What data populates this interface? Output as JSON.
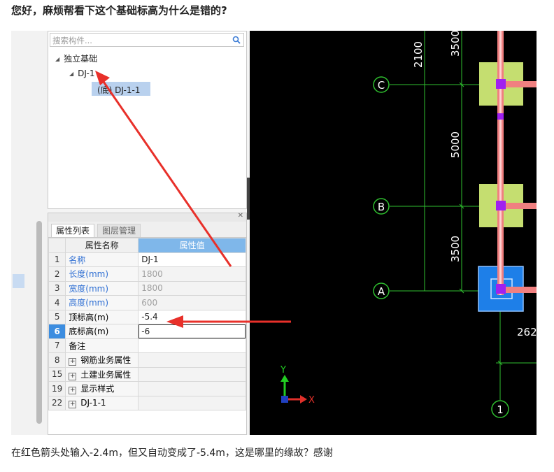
{
  "question_title": "您好，麻烦帮看下这个基础标高为什么是错的?",
  "caption": "在红色箭头处输入-2.4m，但又自动变成了-5.4m，这是哪里的缘故？感谢",
  "tree": {
    "search_placeholder": "搜索构件...",
    "root_label": "独立基础",
    "child_label": "DJ-1",
    "leaf_label": "(底) DJ-1-1"
  },
  "property_panel": {
    "tabs": [
      "属性列表",
      "图层管理"
    ],
    "header_name": "属性名称",
    "header_value": "属性值",
    "rows": [
      {
        "num": "1",
        "name": "名称",
        "value": "DJ-1"
      },
      {
        "num": "2",
        "name": "长度(mm)",
        "value": "1800"
      },
      {
        "num": "3",
        "name": "宽度(mm)",
        "value": "1800"
      },
      {
        "num": "4",
        "name": "高度(mm)",
        "value": "600"
      },
      {
        "num": "5",
        "name": "顶标高(m)",
        "value": "-5.4"
      },
      {
        "num": "6",
        "name": "底标高(m)",
        "value": "-6"
      },
      {
        "num": "7",
        "name": "备注",
        "value": ""
      },
      {
        "num": "8",
        "name": "钢筋业务属性",
        "value": ""
      },
      {
        "num": "15",
        "name": "土建业务属性",
        "value": ""
      },
      {
        "num": "19",
        "name": "显示样式",
        "value": ""
      },
      {
        "num": "22",
        "name": "DJ-1-1",
        "value": ""
      }
    ]
  },
  "cad": {
    "dimensions": [
      "2100",
      "3500",
      "5000",
      "3500",
      "262"
    ],
    "axis_labels": [
      "C",
      "B",
      "A",
      "1"
    ],
    "ucs_x": "X",
    "ucs_y": "Y"
  },
  "colors": {
    "arrow_red": "#e8302a",
    "footing_green": "#c5de70",
    "footing_selected": "#1e7fe8",
    "grid_line": "#2fbf2f",
    "column_magenta": "#a020f0",
    "beam_pink": "#f08080"
  }
}
